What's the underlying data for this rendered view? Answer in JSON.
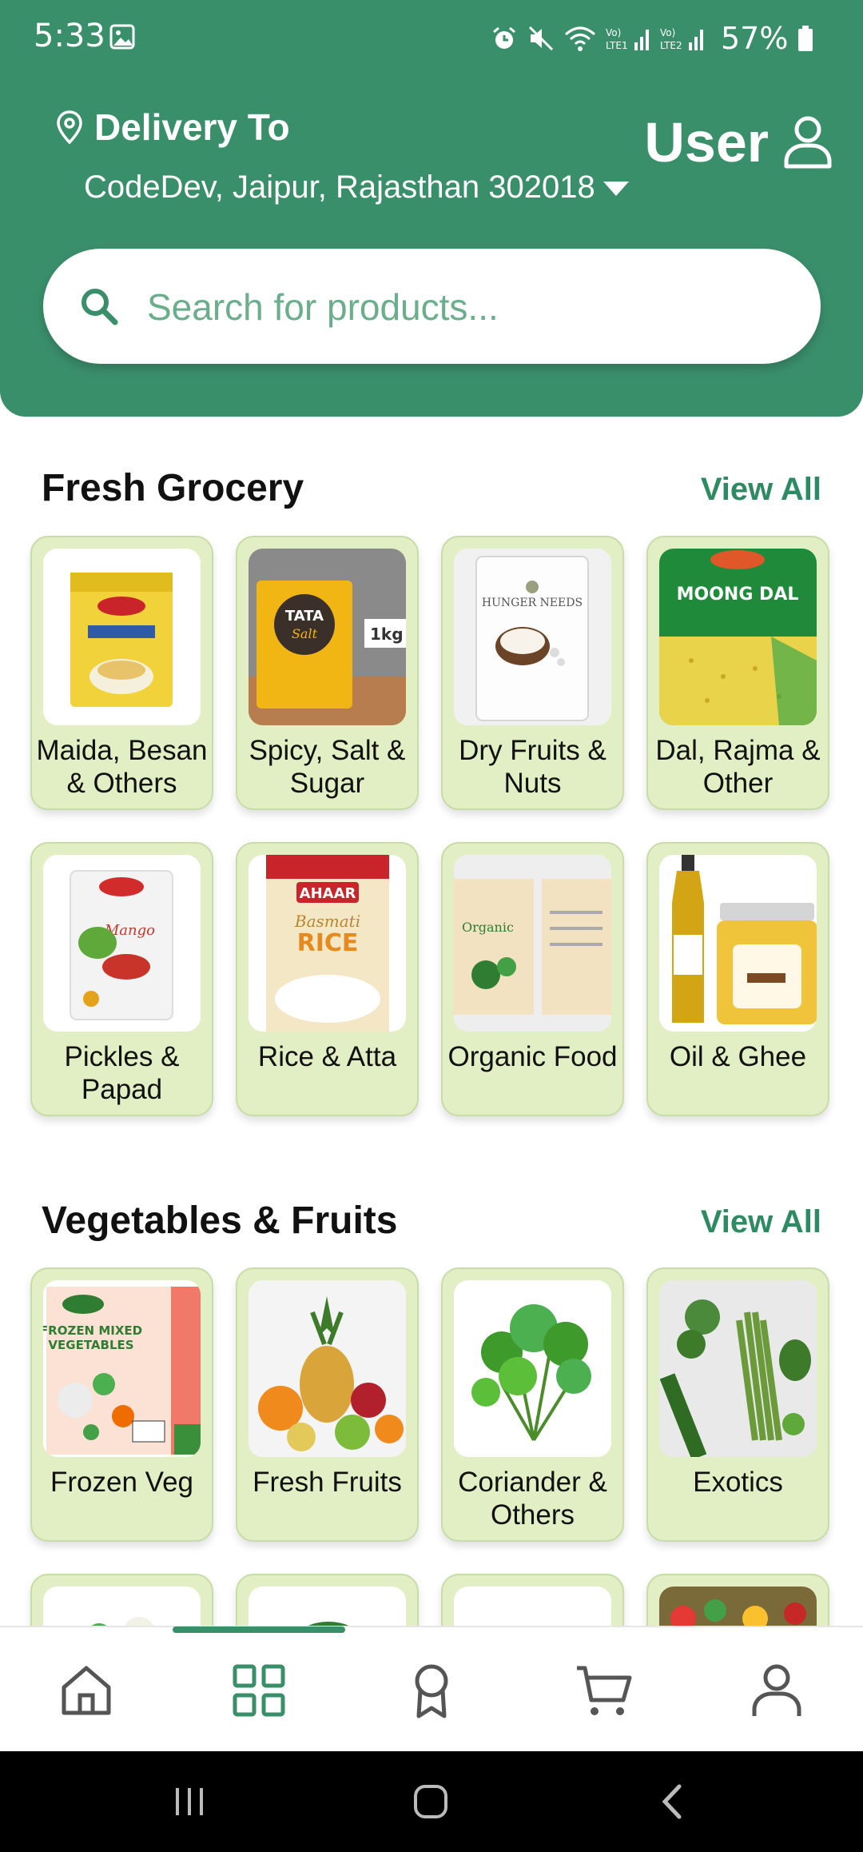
{
  "status_bar": {
    "time": "5:33",
    "battery": "57%"
  },
  "header": {
    "delivery_label": "Delivery To",
    "address": "CodeDev, Jaipur, Rajasthan 302018",
    "user_label": "User"
  },
  "search": {
    "placeholder": "Search for products..."
  },
  "sections": [
    {
      "title": "Fresh Grocery",
      "view_all": "View All",
      "items": [
        {
          "label": "Maida, Besan & Others",
          "image": "besan-packet"
        },
        {
          "label": "Spicy, Salt & Sugar",
          "image": "salt-packet"
        },
        {
          "label": "Dry Fruits & Nuts",
          "image": "coconut-pouch"
        },
        {
          "label": "Dal, Rajma & Other",
          "image": "moong-dal-pouch"
        },
        {
          "label": "Pickles & Papad",
          "image": "mango-pickle-pouch"
        },
        {
          "label": "Rice & Atta",
          "image": "basmati-rice-bag"
        },
        {
          "label": "Organic Food",
          "image": "organic-pouches"
        },
        {
          "label": "Oil & Ghee",
          "image": "oil-ghee-jars"
        }
      ]
    },
    {
      "title": "Vegetables & Fruits",
      "view_all": "View All",
      "items": [
        {
          "label": "Frozen Veg",
          "image": "frozen-veg-pack"
        },
        {
          "label": "Fresh Fruits",
          "image": "fruit-basket"
        },
        {
          "label": "Coriander & Others",
          "image": "coriander-bunch"
        },
        {
          "label": "Exotics",
          "image": "exotic-vegetables"
        }
      ]
    }
  ],
  "bottom_nav": [
    {
      "name": "home",
      "active": false
    },
    {
      "name": "categories",
      "active": true
    },
    {
      "name": "rewards",
      "active": false
    },
    {
      "name": "cart",
      "active": false
    },
    {
      "name": "account",
      "active": false
    }
  ],
  "colors": {
    "primary": "#3a8f6b",
    "card_bg": "#e2efc4",
    "link": "#2e8a63"
  }
}
